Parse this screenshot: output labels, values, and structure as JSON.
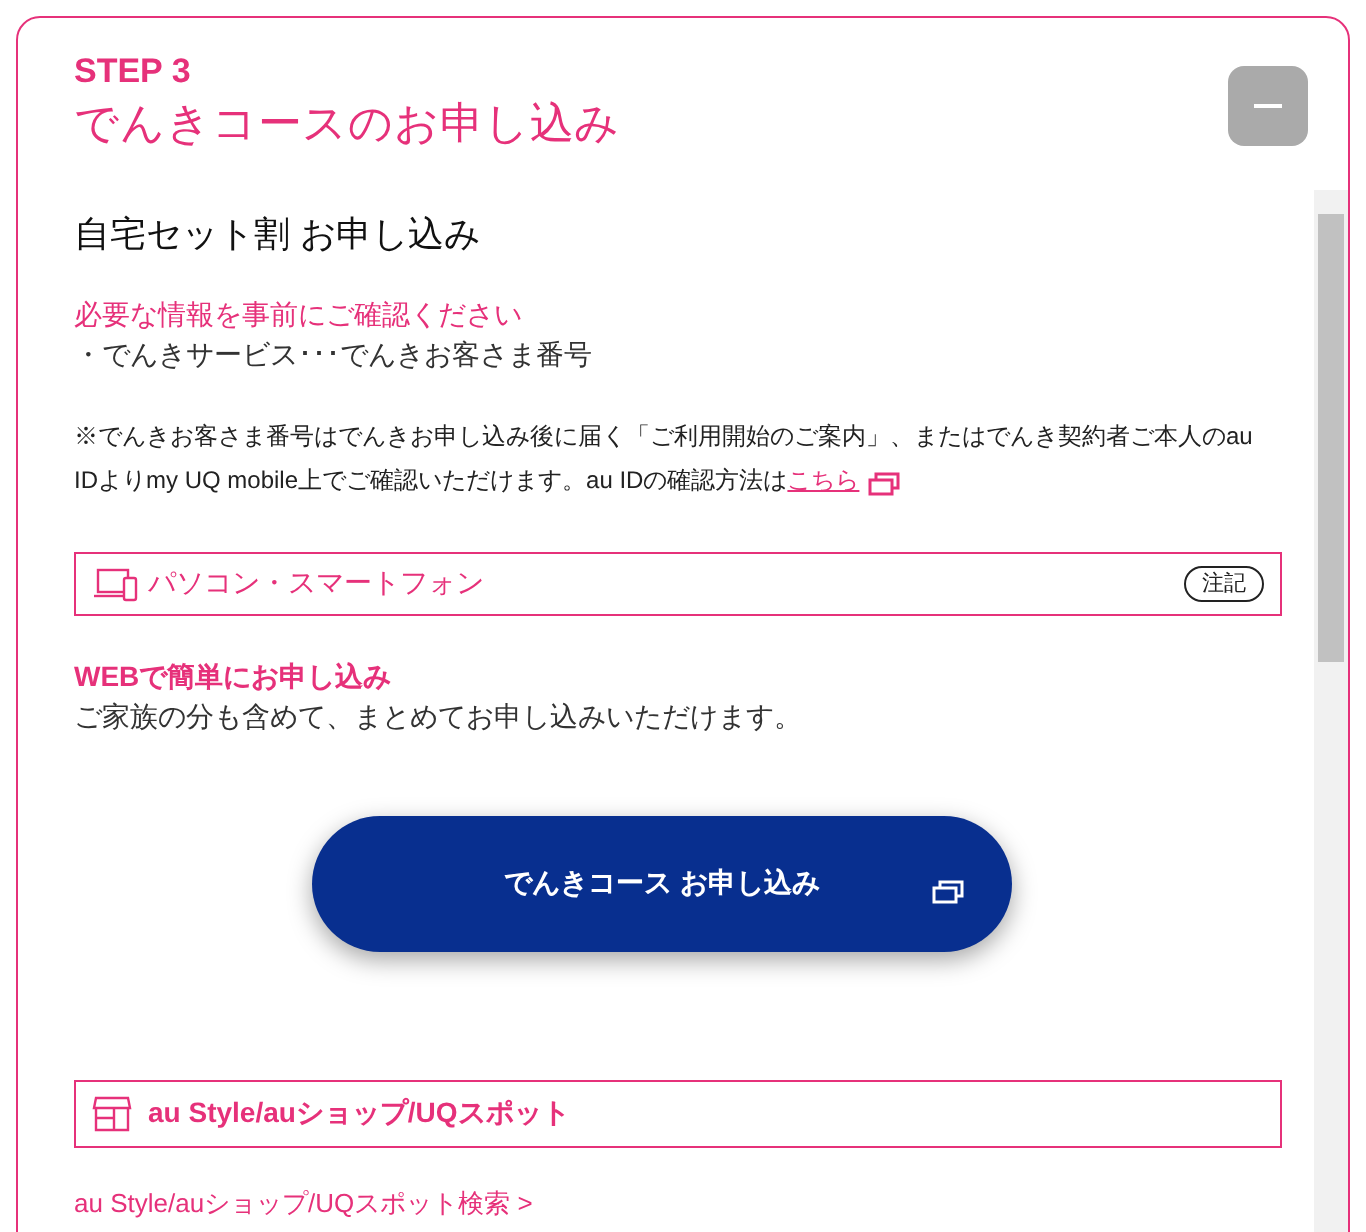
{
  "step": "STEP 3",
  "title": "でんきコースのお申し込み",
  "section_title": "自宅セット割 お申し込み",
  "notice_heading": "必要な情報を事前にご確認ください",
  "notice_item": "・でんきサービス･･･でんきお客さま番号",
  "note": "※でんきお客さま番号はでんきお申し込み後に届く「ご利用開始のご案内」、またはでんき契約者ご本人のau IDよりmy UQ mobile上でご確認いただけます。au IDの確認方法は",
  "note_link": "こちら",
  "pc_panel": {
    "label": "パソコン・スマートフォン",
    "badge": "注記"
  },
  "web_heading": "WEBで簡単にお申し込み",
  "web_text": "ご家族の分も含めて、まとめてお申し込みいただけます。",
  "apply_button": "でんきコース お申し込み",
  "shop_panel": {
    "label": "au Style/auショップ/UQスポット"
  },
  "shop_link": "au Style/auショップ/UQスポット検索 >"
}
